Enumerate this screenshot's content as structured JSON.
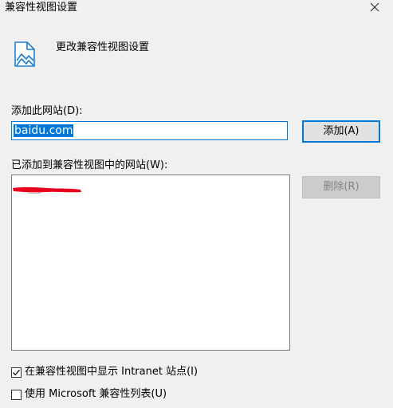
{
  "window": {
    "title": "兼容性视图设置",
    "close_icon": "close-icon"
  },
  "header": {
    "icon": "compatibility-view-icon",
    "heading": "更改兼容性视图设置"
  },
  "add_site": {
    "label": "添加此网站(D):",
    "value": "baidu.com",
    "button_label": "添加(A)"
  },
  "added_sites": {
    "label": "已添加到兼容性视图中的网站(W):",
    "items": [
      "[redacted]"
    ],
    "remove_button_label": "删除(R)",
    "remove_enabled": false
  },
  "options": {
    "intranet": {
      "label": "在兼容性视图中显示 Intranet 站点(I)",
      "checked": true
    },
    "microsoft_list": {
      "label": "使用 Microsoft 兼容性列表(U)",
      "checked": false
    }
  },
  "colors": {
    "background": "#f0f0f0",
    "accent": "#0078d7",
    "icon": "#1e7fd1",
    "redaction": "#e8001c"
  }
}
